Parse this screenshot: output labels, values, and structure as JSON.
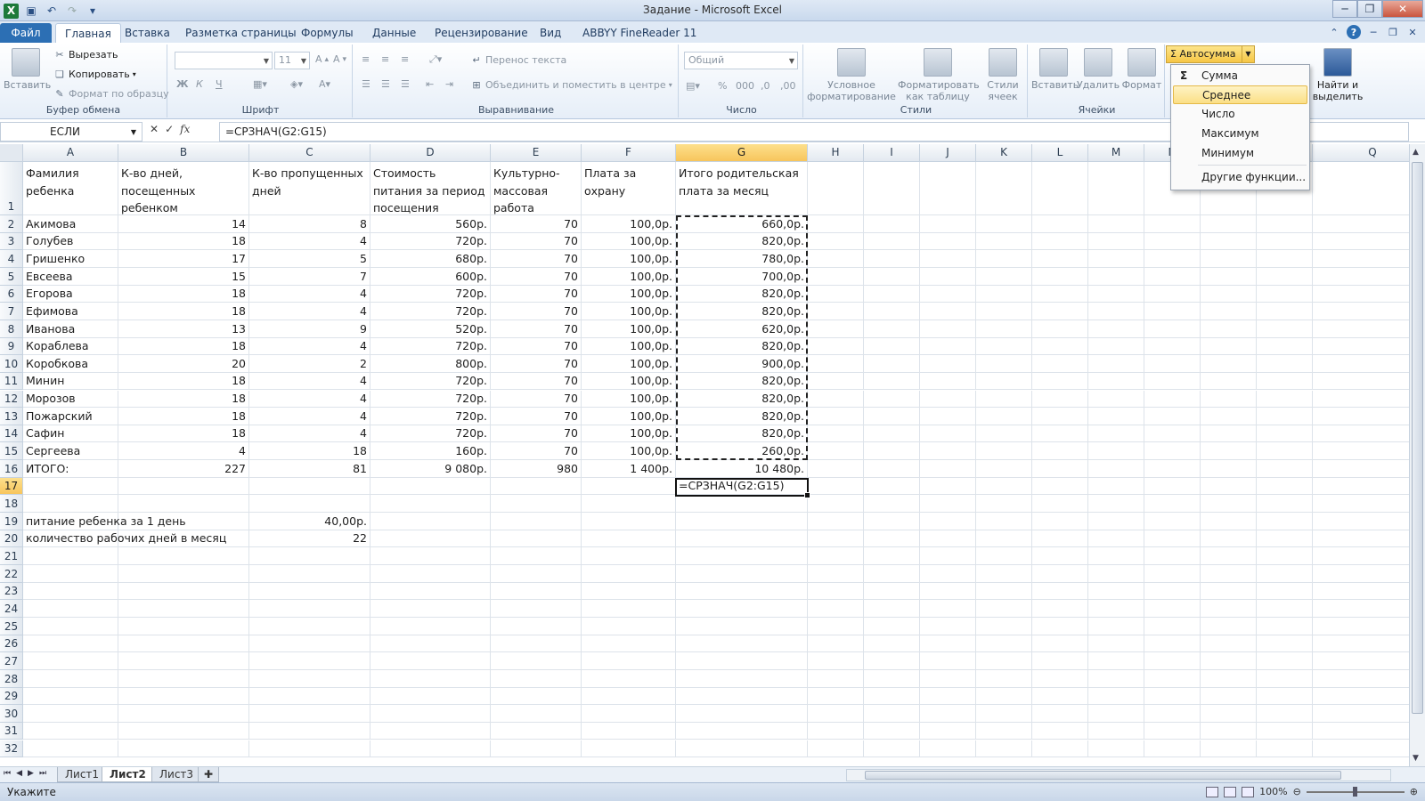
{
  "app": {
    "title": "Задание - Microsoft Excel",
    "logo": "X"
  },
  "tabs": {
    "file": "Файл",
    "items": [
      "Главная",
      "Вставка",
      "Разметка страницы",
      "Формулы",
      "Данные",
      "Рецензирование",
      "Вид",
      "ABBYY FineReader 11"
    ]
  },
  "ribbon": {
    "clipboard": {
      "paste": "Вставить",
      "cut": "Вырезать",
      "copy": "Копировать",
      "format_painter": "Формат по образцу",
      "label": "Буфер обмена"
    },
    "font": {
      "name": "",
      "size": "11",
      "bold": "Ж",
      "italic": "К",
      "underline": "Ч",
      "label": "Шрифт"
    },
    "alignment": {
      "wrap": "Перенос текста",
      "merge": "Объединить и поместить в центре",
      "label": "Выравнивание"
    },
    "number": {
      "format": "Общий",
      "label": "Число"
    },
    "styles": {
      "conditional": "Условное форматирование",
      "as_table": "Форматировать как таблицу",
      "cell_styles": "Стили ячеек",
      "label": "Стили"
    },
    "cells": {
      "insert": "Вставить",
      "delete": "Удалить",
      "format": "Формат",
      "label": "Ячейки"
    },
    "editing": {
      "autosum": "Автосумма",
      "find": "Найти и выделить"
    }
  },
  "formula_bar": {
    "name_box": "ЕСЛИ",
    "formula": "=СРЗНАЧ(G2:G15)"
  },
  "columns": [
    "A",
    "B",
    "C",
    "D",
    "E",
    "F",
    "G",
    "H",
    "I",
    "J",
    "K",
    "L",
    "M",
    "N",
    "O",
    "P",
    "Q"
  ],
  "headers": [
    "Фамилия ребенка",
    "К-во дней, посещенных ребенком",
    "К-во пропущенных дней",
    "Стоимость питания за период посещения",
    "Культурно-массовая работа",
    "Плата за охрану",
    "Итого родительская плата за месяц"
  ],
  "rows": [
    [
      "Акимова",
      "14",
      "8",
      "560р.",
      "70",
      "100,0р.",
      "660,0р."
    ],
    [
      "Голубев",
      "18",
      "4",
      "720р.",
      "70",
      "100,0р.",
      "820,0р."
    ],
    [
      "Гришенко",
      "17",
      "5",
      "680р.",
      "70",
      "100,0р.",
      "780,0р."
    ],
    [
      "Евсеева",
      "15",
      "7",
      "600р.",
      "70",
      "100,0р.",
      "700,0р."
    ],
    [
      "Егорова",
      "18",
      "4",
      "720р.",
      "70",
      "100,0р.",
      "820,0р."
    ],
    [
      "Ефимова",
      "18",
      "4",
      "720р.",
      "70",
      "100,0р.",
      "820,0р."
    ],
    [
      "Иванова",
      "13",
      "9",
      "520р.",
      "70",
      "100,0р.",
      "620,0р."
    ],
    [
      "Кораблева",
      "18",
      "4",
      "720р.",
      "70",
      "100,0р.",
      "820,0р."
    ],
    [
      "Коробкова",
      "20",
      "2",
      "800р.",
      "70",
      "100,0р.",
      "900,0р."
    ],
    [
      "Минин",
      "18",
      "4",
      "720р.",
      "70",
      "100,0р.",
      "820,0р."
    ],
    [
      "Морозов",
      "18",
      "4",
      "720р.",
      "70",
      "100,0р.",
      "820,0р."
    ],
    [
      "Пожарский",
      "18",
      "4",
      "720р.",
      "70",
      "100,0р.",
      "820,0р."
    ],
    [
      "Сафин",
      "18",
      "4",
      "720р.",
      "70",
      "100,0р.",
      "820,0р."
    ],
    [
      "Сергеева",
      "4",
      "18",
      "160р.",
      "70",
      "100,0р.",
      "260,0р."
    ]
  ],
  "totals": [
    "ИТОГО:",
    "227",
    "81",
    "9 080р.",
    "980",
    "1 400р.",
    "10 480р."
  ],
  "editing_cell": "=СРЗНАЧ(G2:G15)",
  "extra": [
    {
      "label": "питание ребенка за 1 день",
      "value": "40,00р."
    },
    {
      "label": "количество рабочих дней в месяц",
      "value": "22"
    }
  ],
  "sheets": [
    "Лист1",
    "Лист2",
    "Лист3"
  ],
  "status": {
    "mode": "Укажите",
    "zoom": "100%"
  },
  "autosum_menu": [
    "Сумма",
    "Среднее",
    "Число",
    "Максимум",
    "Минимум",
    "Другие функции..."
  ]
}
